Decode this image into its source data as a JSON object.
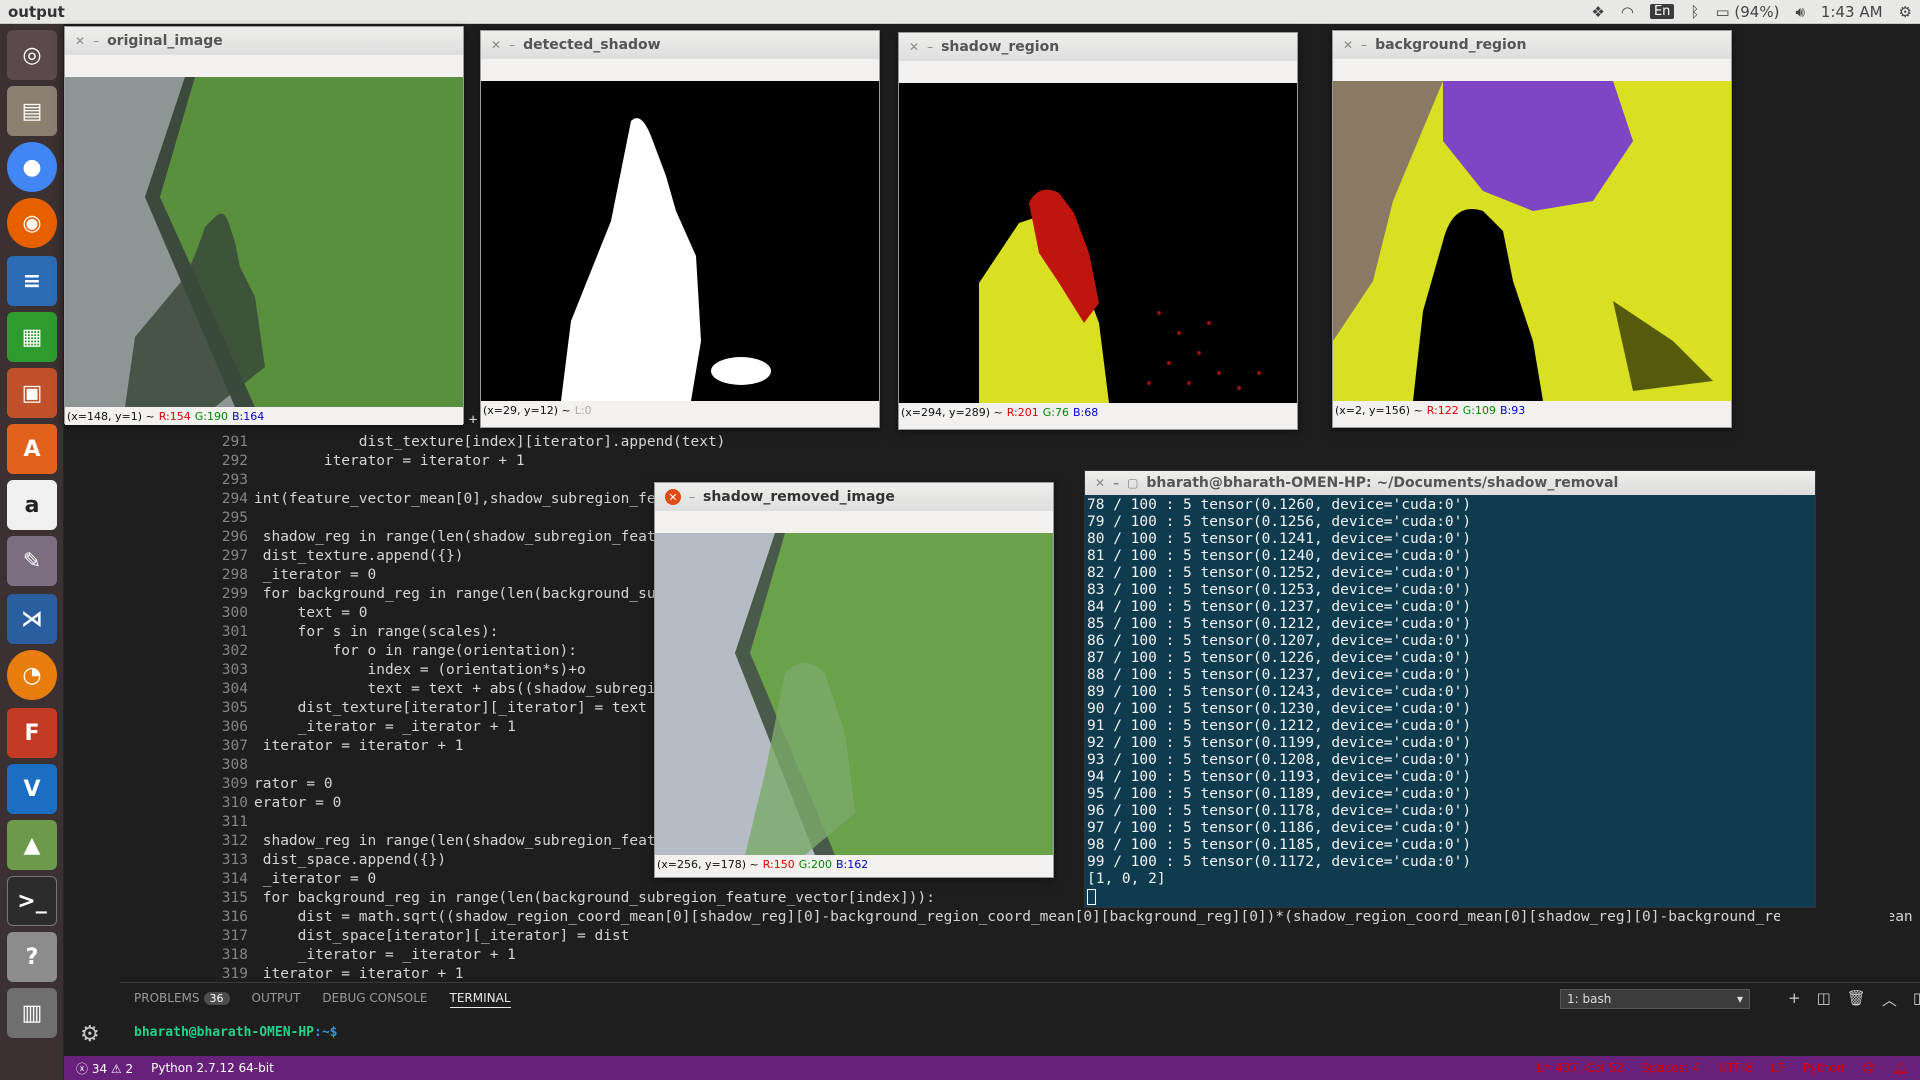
{
  "top_panel": {
    "title": "output",
    "lang": "En",
    "battery": "(94%)",
    "time": "1:43 AM"
  },
  "launcher": {
    "icons": [
      "ubuntu-dash-icon",
      "files-icon",
      "chrome-icon",
      "firefox-icon",
      "writer-icon",
      "calc-icon",
      "impress-icon",
      "software-center-icon",
      "amazon-icon",
      "system-settings-icon",
      "vscode-icon",
      "blender-icon",
      "freecad-icon",
      "vnc-icon",
      "inkscape-icon",
      "terminal-icon",
      "help-icon",
      "workspaces-icon"
    ]
  },
  "editor": {
    "gutter": [
      "291",
      "292",
      "293",
      "294",
      "295",
      "296",
      "297",
      "298",
      "299",
      "300",
      "301",
      "302",
      "303",
      "304",
      "305",
      "306",
      "307",
      "308",
      "309",
      "310",
      "311",
      "312",
      "313",
      "314",
      "315",
      "316",
      "317",
      "318",
      "319"
    ],
    "lines": [
      "            dist_texture[index][iterator].append(text)",
      "        iterator = iterator + 1",
      "",
      "int(feature_vector_mean[0],shadow_subregion_feature_vect",
      "",
      " shadow_reg in range(len(shadow_subregion_feature_vector",
      " dist_texture.append({})",
      " _iterator = 0",
      " for background_reg in range(len(background_subregion_fe",
      "     text = 0",
      "     for s in range(scales):",
      "         for o in range(orientation):",
      "             index = (orientation*s)+o",
      "             text = text + abs((shadow_subregion_feature",
      "     dist_texture[iterator][_iterator] = text",
      "     _iterator = _iterator + 1",
      " iterator = iterator + 1",
      "",
      "rator = 0",
      "erator = 0",
      "",
      " shadow_reg in range(len(shadow_subregion_feature_vector",
      " dist_space.append({})",
      " _iterator = 0",
      " for background_reg in range(len(background_subregion_feature_vector[index])):",
      "     dist = math.sqrt((shadow_region_coord_mean[0][shadow_reg][0]-background_region_coord_mean[0][background_reg][0])*(shadow_region_coord_mean[0][shadow_reg][0]-background_region_coord_mean",
      "     dist_space[iterator][_iterator] = dist",
      "     _iterator = _iterator + 1",
      " iterator = iterator + 1"
    ],
    "partial_line_290": "text = text + abs((s"
  },
  "panel": {
    "tabs": [
      "PROBLEMS",
      "OUTPUT",
      "DEBUG CONSOLE",
      "TERMINAL"
    ],
    "problems_count": "36",
    "terminal_select": "1: bash",
    "prompt_user": "bharath@bharath-OMEN-HP",
    "prompt_path": ":~$"
  },
  "statusbar": {
    "errors": "34",
    "warnings": "2",
    "interpreter": "Python 2.7.12 64-bit",
    "position": "Ln 437, Col 52",
    "spaces": "Spaces: 4",
    "encoding": "UTF-8",
    "eol": "LF",
    "language": "Python"
  },
  "windows": {
    "original": {
      "title": "original_image",
      "status_pos": "(x=148, y=1) ~",
      "r": "R:154",
      "g": "G:190",
      "b": "B:164"
    },
    "detected": {
      "title": "detected_shadow",
      "status_pos": "(x=29, y=12) ~",
      "l": "L:0"
    },
    "shadow_region": {
      "title": "shadow_region",
      "status_pos": "(x=294, y=289) ~",
      "r": "R:201",
      "g": "G:76",
      "b": "B:68"
    },
    "background": {
      "title": "background_region",
      "status_pos": "(x=2, y=156) ~",
      "r": "R:122",
      "g": "G:109",
      "b": "B:93"
    },
    "removed": {
      "title": "shadow_removed_image",
      "status_pos": "(x=256, y=178) ~",
      "r": "R:150",
      "g": "G:200",
      "b": "B:162"
    }
  },
  "terminal": {
    "title": "bharath@bharath-OMEN-HP: ~/Documents/shadow_removal",
    "lines": [
      "78 / 100 : 5 tensor(0.1260, device='cuda:0')",
      "79 / 100 : 5 tensor(0.1256, device='cuda:0')",
      "80 / 100 : 5 tensor(0.1241, device='cuda:0')",
      "81 / 100 : 5 tensor(0.1240, device='cuda:0')",
      "82 / 100 : 5 tensor(0.1252, device='cuda:0')",
      "83 / 100 : 5 tensor(0.1253, device='cuda:0')",
      "84 / 100 : 5 tensor(0.1237, device='cuda:0')",
      "85 / 100 : 5 tensor(0.1212, device='cuda:0')",
      "86 / 100 : 5 tensor(0.1207, device='cuda:0')",
      "87 / 100 : 5 tensor(0.1226, device='cuda:0')",
      "88 / 100 : 5 tensor(0.1237, device='cuda:0')",
      "89 / 100 : 5 tensor(0.1243, device='cuda:0')",
      "90 / 100 : 5 tensor(0.1230, device='cuda:0')",
      "91 / 100 : 5 tensor(0.1212, device='cuda:0')",
      "92 / 100 : 5 tensor(0.1199, device='cuda:0')",
      "93 / 100 : 5 tensor(0.1208, device='cuda:0')",
      "94 / 100 : 5 tensor(0.1193, device='cuda:0')",
      "95 / 100 : 5 tensor(0.1189, device='cuda:0')",
      "96 / 100 : 5 tensor(0.1178, device='cuda:0')",
      "97 / 100 : 5 tensor(0.1186, device='cuda:0')",
      "98 / 100 : 5 tensor(0.1185, device='cuda:0')",
      "99 / 100 : 5 tensor(0.1172, device='cuda:0')",
      "[1, 0, 2]"
    ]
  }
}
